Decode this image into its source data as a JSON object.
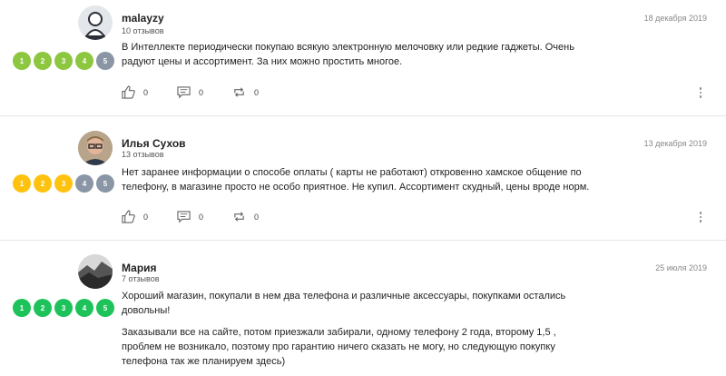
{
  "colors": {
    "green": "#8dc63f",
    "gray": "#8a96a5",
    "yellow": "#ffc20e",
    "emerald": "#1dc35a"
  },
  "reviews": [
    {
      "author": "malayzy",
      "review_count": "10 отзывов",
      "date": "18 декабря 2019",
      "paragraphs": [
        "В Интеллекте периодически покупаю всякую электронную мелочовку или редкие гаджеты. Очень радуют цены и ассортимент. За них можно простить многое."
      ],
      "rating": 4,
      "rating_labels": [
        "1",
        "2",
        "3",
        "4",
        "5"
      ],
      "likes": "0",
      "comments": "0",
      "reposts": "0"
    },
    {
      "author": "Илья Сухов",
      "review_count": "13 отзывов",
      "date": "13 декабря 2019",
      "paragraphs": [
        "Нет заранее информации о способе оплаты ( карты не работают) откровенно хамское общение по телефону, в магазине просто не особо приятное. Не купил. Ассортимент скудный, цены вроде норм."
      ],
      "rating": 3,
      "rating_labels": [
        "1",
        "2",
        "3",
        "4",
        "5"
      ],
      "likes": "0",
      "comments": "0",
      "reposts": "0"
    },
    {
      "author": "Мария",
      "review_count": "7 отзывов",
      "date": "25 июля 2019",
      "paragraphs": [
        "Хороший магазин, покупали в нем два телефона и различные аксессуары, покупками остались довольны!",
        "Заказывали все на сайте, потом приезжали забирали, одному телефону 2 года, второму 1,5 , проблем не возникало, поэтому про гарантию ничего сказать не могу, но следующую покупку телефона так же планируем здесь)"
      ],
      "rating": 5,
      "rating_labels": [
        "1",
        "2",
        "3",
        "4",
        "5"
      ]
    }
  ]
}
